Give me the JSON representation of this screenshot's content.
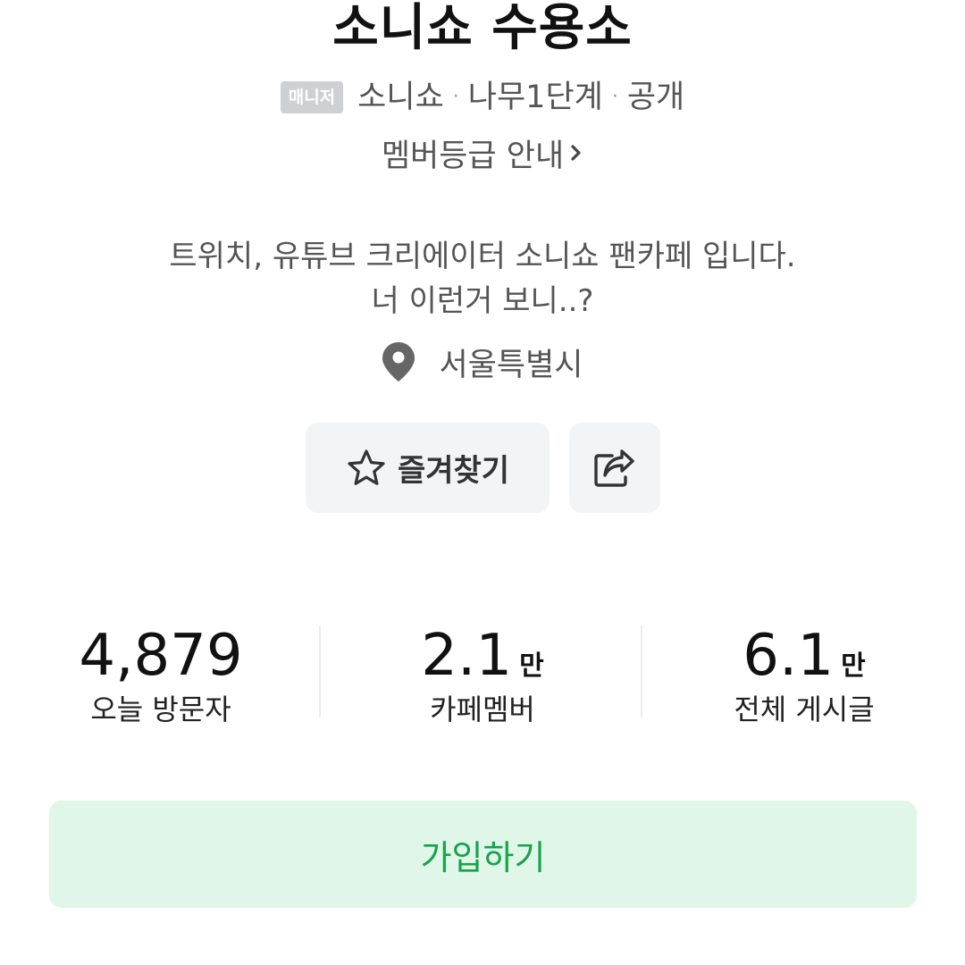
{
  "cafe": {
    "title": "소니쇼 수용소",
    "manager_badge": "매니저",
    "owner": "소니쇼",
    "level": "나무1단계",
    "visibility": "공개",
    "grade_info": "멤버등급 안내",
    "description_line1": "트위치, 유튜브 크리에이터 소니쇼 팬카페 입니다.",
    "description_line2": "너 이런거 보니..?",
    "location": "서울특별시",
    "location_icon": "location-pin-icon"
  },
  "actions": {
    "favorite_label": "즐겨찾기",
    "favorite_icon": "star-icon",
    "share_icon": "share-icon"
  },
  "stats": [
    {
      "value": "4,879",
      "unit": "",
      "label": "오늘 방문자"
    },
    {
      "value": "2.1",
      "unit": "만",
      "label": "카페멤버"
    },
    {
      "value": "6.1",
      "unit": "만",
      "label": "전체 게시글"
    }
  ],
  "join": {
    "label": "가입하기"
  },
  "colors": {
    "join_bg": "#dff6e8",
    "join_text": "#16a34a",
    "badge_bg": "#cfd0d3",
    "button_bg": "#f3f4f6"
  }
}
